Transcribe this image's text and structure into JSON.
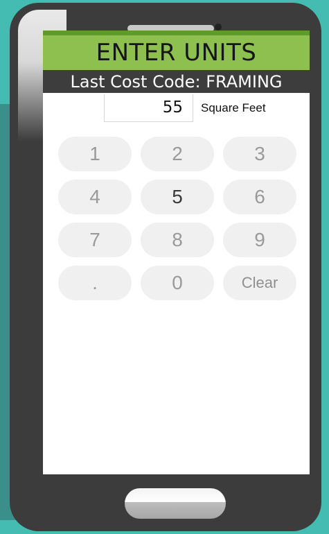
{
  "header": {
    "title": "ENTER UNITS"
  },
  "subheader": {
    "text": "Last Cost Code: FRAMING"
  },
  "entry": {
    "value": "55",
    "unit_label": "Square Feet"
  },
  "keypad": {
    "keys": [
      "1",
      "2",
      "3",
      "4",
      "5",
      "6",
      "7",
      "8",
      "9",
      ".",
      "0",
      "Clear"
    ]
  },
  "colors": {
    "header_green": "#8dc04f",
    "accent_green": "#5e9b2a",
    "subheader_dark": "#3d3d3d",
    "background_teal": "#44bcb2"
  }
}
